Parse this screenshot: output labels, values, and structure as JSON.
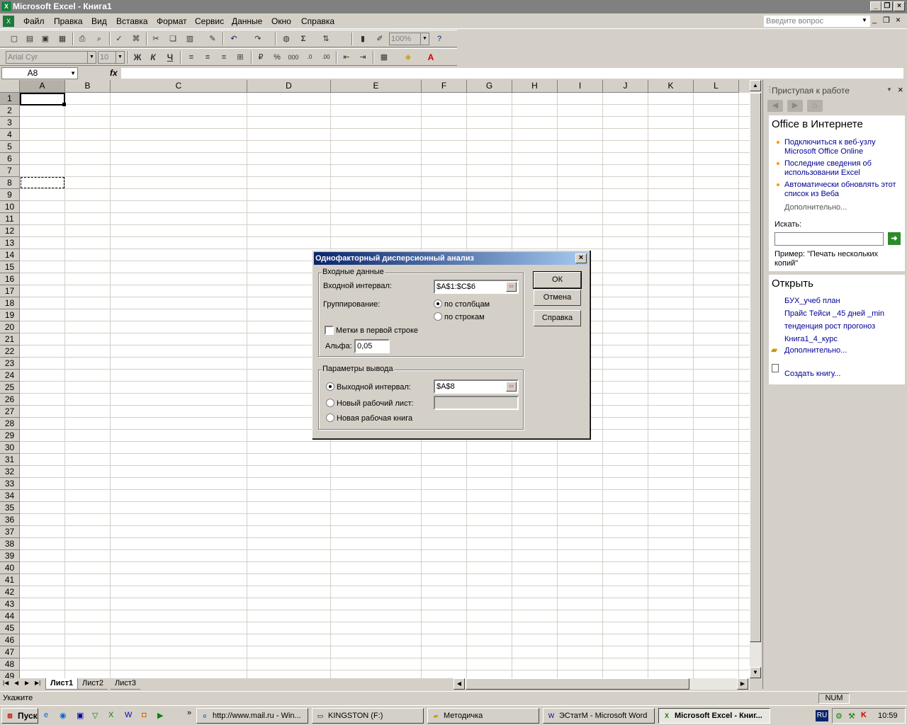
{
  "window": {
    "title": "Microsoft Excel - Книга1"
  },
  "menu": {
    "items": [
      "Файл",
      "Правка",
      "Вид",
      "Вставка",
      "Формат",
      "Сервис",
      "Данные",
      "Окно",
      "Справка"
    ],
    "help_placeholder": "Введите вопрос"
  },
  "toolbar": {
    "zoom": "100%",
    "font": "Arial Cyr",
    "size": "10",
    "bold": "Ж",
    "italic": "К",
    "underline": "Ч"
  },
  "formula": {
    "cell_ref": "A8",
    "fx": "fx"
  },
  "columns": [
    "A",
    "B",
    "C",
    "D",
    "E",
    "F",
    "G",
    "H",
    "I",
    "J",
    "K",
    "L"
  ],
  "rows": [
    "1",
    "2",
    "3",
    "4",
    "5",
    "6",
    "7",
    "8",
    "9",
    "10",
    "11",
    "12",
    "13",
    "14",
    "15",
    "16",
    "17",
    "18",
    "19",
    "20",
    "21",
    "22",
    "23",
    "24",
    "25",
    "26",
    "27",
    "28",
    "29",
    "30",
    "31",
    "32",
    "33",
    "34",
    "35",
    "36",
    "37",
    "38",
    "39",
    "40",
    "41",
    "42",
    "43",
    "44",
    "45",
    "46",
    "47",
    "48",
    "49"
  ],
  "sheets": [
    "Лист1",
    "Лист2",
    "Лист3"
  ],
  "taskpane": {
    "title": "Приступая к работе",
    "office_online": "Office в Интернете",
    "links": [
      "Подключиться к веб-узлу Microsoft Office Online",
      "Последние сведения об использовании Excel",
      "Автоматически обновлять этот список из Веба"
    ],
    "more": "Дополнительно...",
    "search_label": "Искать:",
    "example": "Пример:  \"Печать нескольких копий\"",
    "open_title": "Открыть",
    "files": [
      "БУХ_учеб план",
      "Прайс Тейси _45 дней _min",
      "тенденция рост прогоноз",
      "Книга1_4_курс"
    ],
    "more_files": "Дополнительно...",
    "new_book": "Создать книгу..."
  },
  "dialog": {
    "title": "Однофакторный дисперсионный анализ",
    "input_group": "Входные данные",
    "input_range_label": "Входной интервал:",
    "input_range": "$A$1:$C$6",
    "grouping_label": "Группирование:",
    "by_columns": "по столбцам",
    "by_rows": "по строкам",
    "labels_first_row": "Метки в первой строке",
    "alpha_label": "Альфа:",
    "alpha": "0,05",
    "output_group": "Параметры вывода",
    "output_range_label": "Выходной интервал:",
    "output_range": "$A$8",
    "new_sheet": "Новый рабочий лист:",
    "new_book": "Новая рабочая книга",
    "ok": "ОК",
    "cancel": "Отмена",
    "help": "Справка"
  },
  "status": {
    "left": "Укажите",
    "num": "NUM"
  },
  "taskbar": {
    "start": "Пуск",
    "items": [
      "http://www.mail.ru - Win...",
      "KINGSTON (F:)",
      "Методичка",
      "ЭСтатМ - Microsoft Word",
      "Microsoft Excel - Книг..."
    ],
    "lang": "RU",
    "clock": "10:59"
  }
}
